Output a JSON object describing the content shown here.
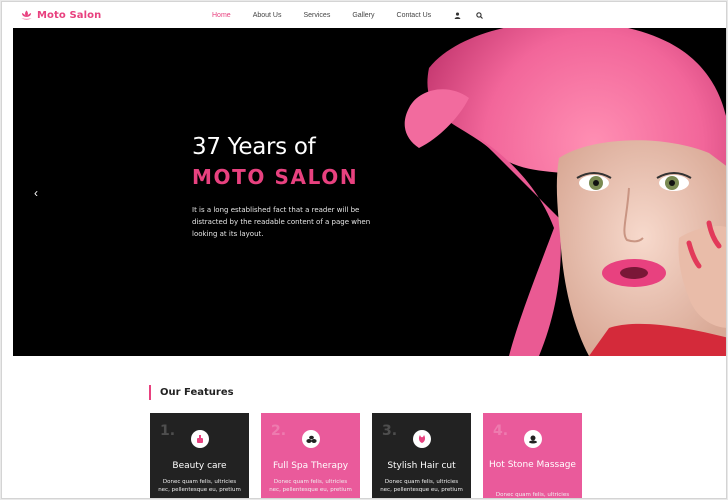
{
  "brand": {
    "name": "Moto Salon",
    "accent": "#e8417f"
  },
  "nav": {
    "items": [
      {
        "label": "Home",
        "active": true
      },
      {
        "label": "About Us",
        "active": false
      },
      {
        "label": "Services",
        "active": false
      },
      {
        "label": "Gallery",
        "active": false
      },
      {
        "label": "Contact Us",
        "active": false
      }
    ],
    "icons": [
      "user-icon",
      "search-icon"
    ]
  },
  "hero": {
    "line1": "37 Years of",
    "line2": "MOTO SALON",
    "description": "It is a long established fact that a reader will be distracted by the readable content of a page when looking at its layout.",
    "prev_arrow": "‹"
  },
  "features": {
    "title": "Our Features",
    "cards": [
      {
        "num": "1.",
        "title": "Beauty care",
        "desc": "Donec quam felis, ultricies nec, pellentesque eu, pretium",
        "theme": "dark",
        "icon": "beauty-care-icon"
      },
      {
        "num": "2.",
        "title": "Full Spa Therapy",
        "desc": "Donec quam felis, ultricies nec, pellentesque eu, pretium",
        "theme": "pink",
        "icon": "spa-stones-icon"
      },
      {
        "num": "3.",
        "title": "Stylish Hair cut",
        "desc": "Donec quam felis, ultricies nec, pellentesque eu, pretium",
        "theme": "dark",
        "icon": "hair-cut-icon"
      },
      {
        "num": "4.",
        "title": "Hot Stone Massage",
        "desc": "Donec quam felis, ultricies nec, pellentesque eu, pretium",
        "theme": "pink",
        "icon": "hot-stone-icon"
      }
    ]
  }
}
